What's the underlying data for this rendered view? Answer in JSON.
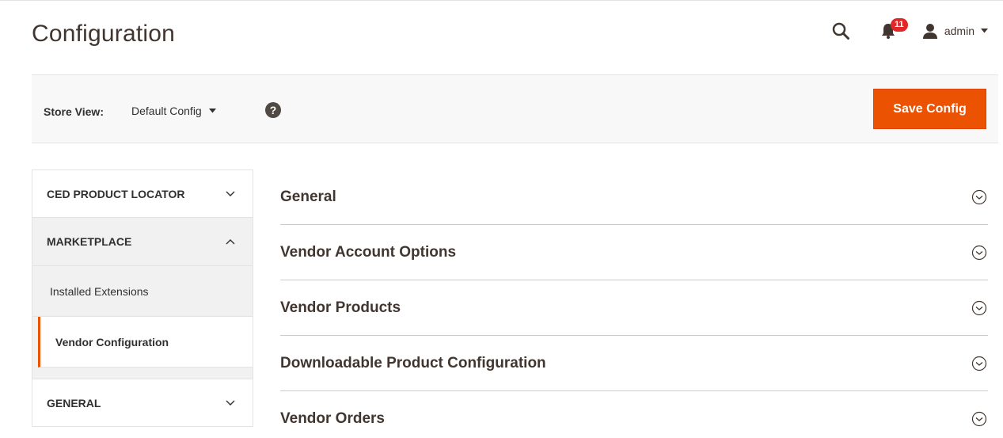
{
  "header": {
    "title": "Configuration",
    "notifications_count": "11",
    "user_name": "admin",
    "icons": [
      "search-icon",
      "bell-icon",
      "user-icon",
      "caret-down-icon"
    ]
  },
  "store_bar": {
    "label": "Store View:",
    "selected_scope": "Default Config",
    "help_glyph": "?",
    "save_label": "Save Config"
  },
  "sidebar": {
    "sections": [
      {
        "label": "CED PRODUCT LOCATOR",
        "expanded": false
      },
      {
        "label": "MARKETPLACE",
        "expanded": true,
        "items": [
          {
            "label": "Installed Extensions",
            "active": false
          },
          {
            "label": "Vendor Configuration",
            "active": true
          }
        ]
      },
      {
        "label": "GENERAL",
        "expanded": false
      }
    ]
  },
  "main": {
    "sections": [
      {
        "title": "General"
      },
      {
        "title": "Vendor Account Options"
      },
      {
        "title": "Vendor Products"
      },
      {
        "title": "Downloadable Product Configuration"
      },
      {
        "title": "Vendor Orders"
      }
    ]
  },
  "colors": {
    "accent": "#eb5202",
    "badge": "#e22626",
    "text": "#303030",
    "bar_bg": "#f8f8f8",
    "sidebar_bg": "#f1f1f1"
  }
}
